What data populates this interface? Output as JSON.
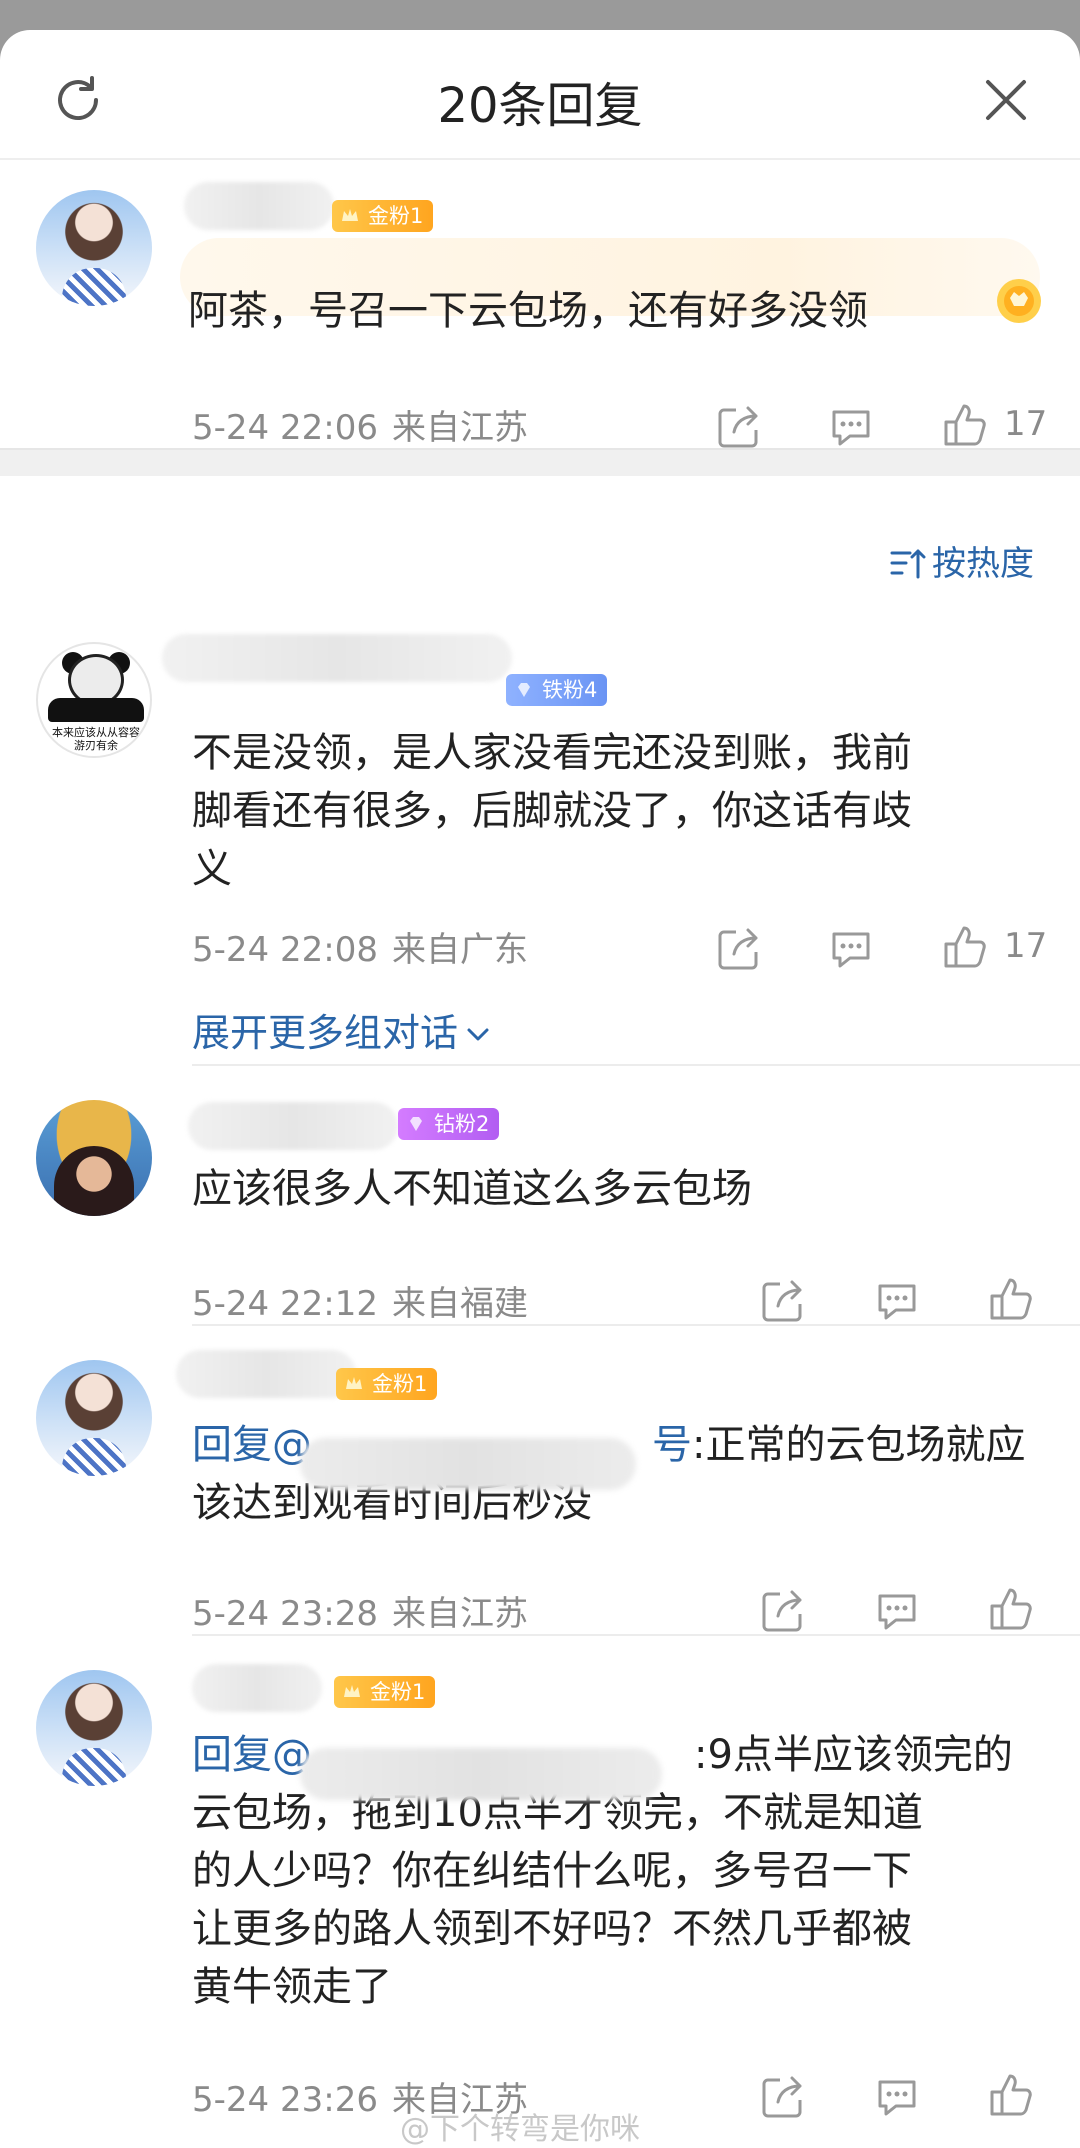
{
  "header": {
    "title": "20条回复",
    "refresh_icon": "refresh-icon",
    "close_icon": "close-icon"
  },
  "root_comment": {
    "badge": "金粉1",
    "text": "阿茶，号召一下云包场，还有好多没领",
    "time": "5-24 22:06",
    "location": "来自江苏",
    "likes": "17"
  },
  "sort": {
    "label": "按热度"
  },
  "replies": [
    {
      "badge": "铁粉4",
      "lines": [
        "不是没领，是人家没看完还没到账，我前",
        "脚看还有很多，后脚就没了，你这话有歧",
        "义"
      ],
      "time": "5-24 22:08",
      "location": "来自广东",
      "likes": "17",
      "avatar_caption": [
        "本来应该从从容容",
        "游刃有余"
      ]
    },
    {
      "badge": "钻粉2",
      "lines": [
        "应该很多人不知道这么多云包场"
      ],
      "time": "5-24 22:12",
      "location": "来自福建"
    },
    {
      "badge": "金粉1",
      "prefix": "回复@",
      "mention_tail": "号",
      "lines": [
        ":正常的云包场就应",
        "该达到观看时间后秒没"
      ],
      "time": "5-24 23:28",
      "location": "来自江苏"
    },
    {
      "badge": "金粉1",
      "prefix": "回复@",
      "lines": [
        ":9点半应该领完的",
        "云包场，拖到10点半才领完，不就是知道",
        "的人少吗？你在纠结什么呢，多号召一下",
        "让更多的路人领到不好吗？不然几乎都被",
        "黄牛领走了"
      ],
      "time": "5-24 23:26",
      "location": "来自江苏"
    }
  ],
  "expand_more": "展开更多组对话",
  "watermark": "@下个转弯是你咪",
  "colors": {
    "link": "#2a65a8",
    "meta": "#8a8a8a",
    "gold_badge": "#ffb02e",
    "iron_badge": "#7aa0f8",
    "diamond_badge": "#c36ef8"
  }
}
